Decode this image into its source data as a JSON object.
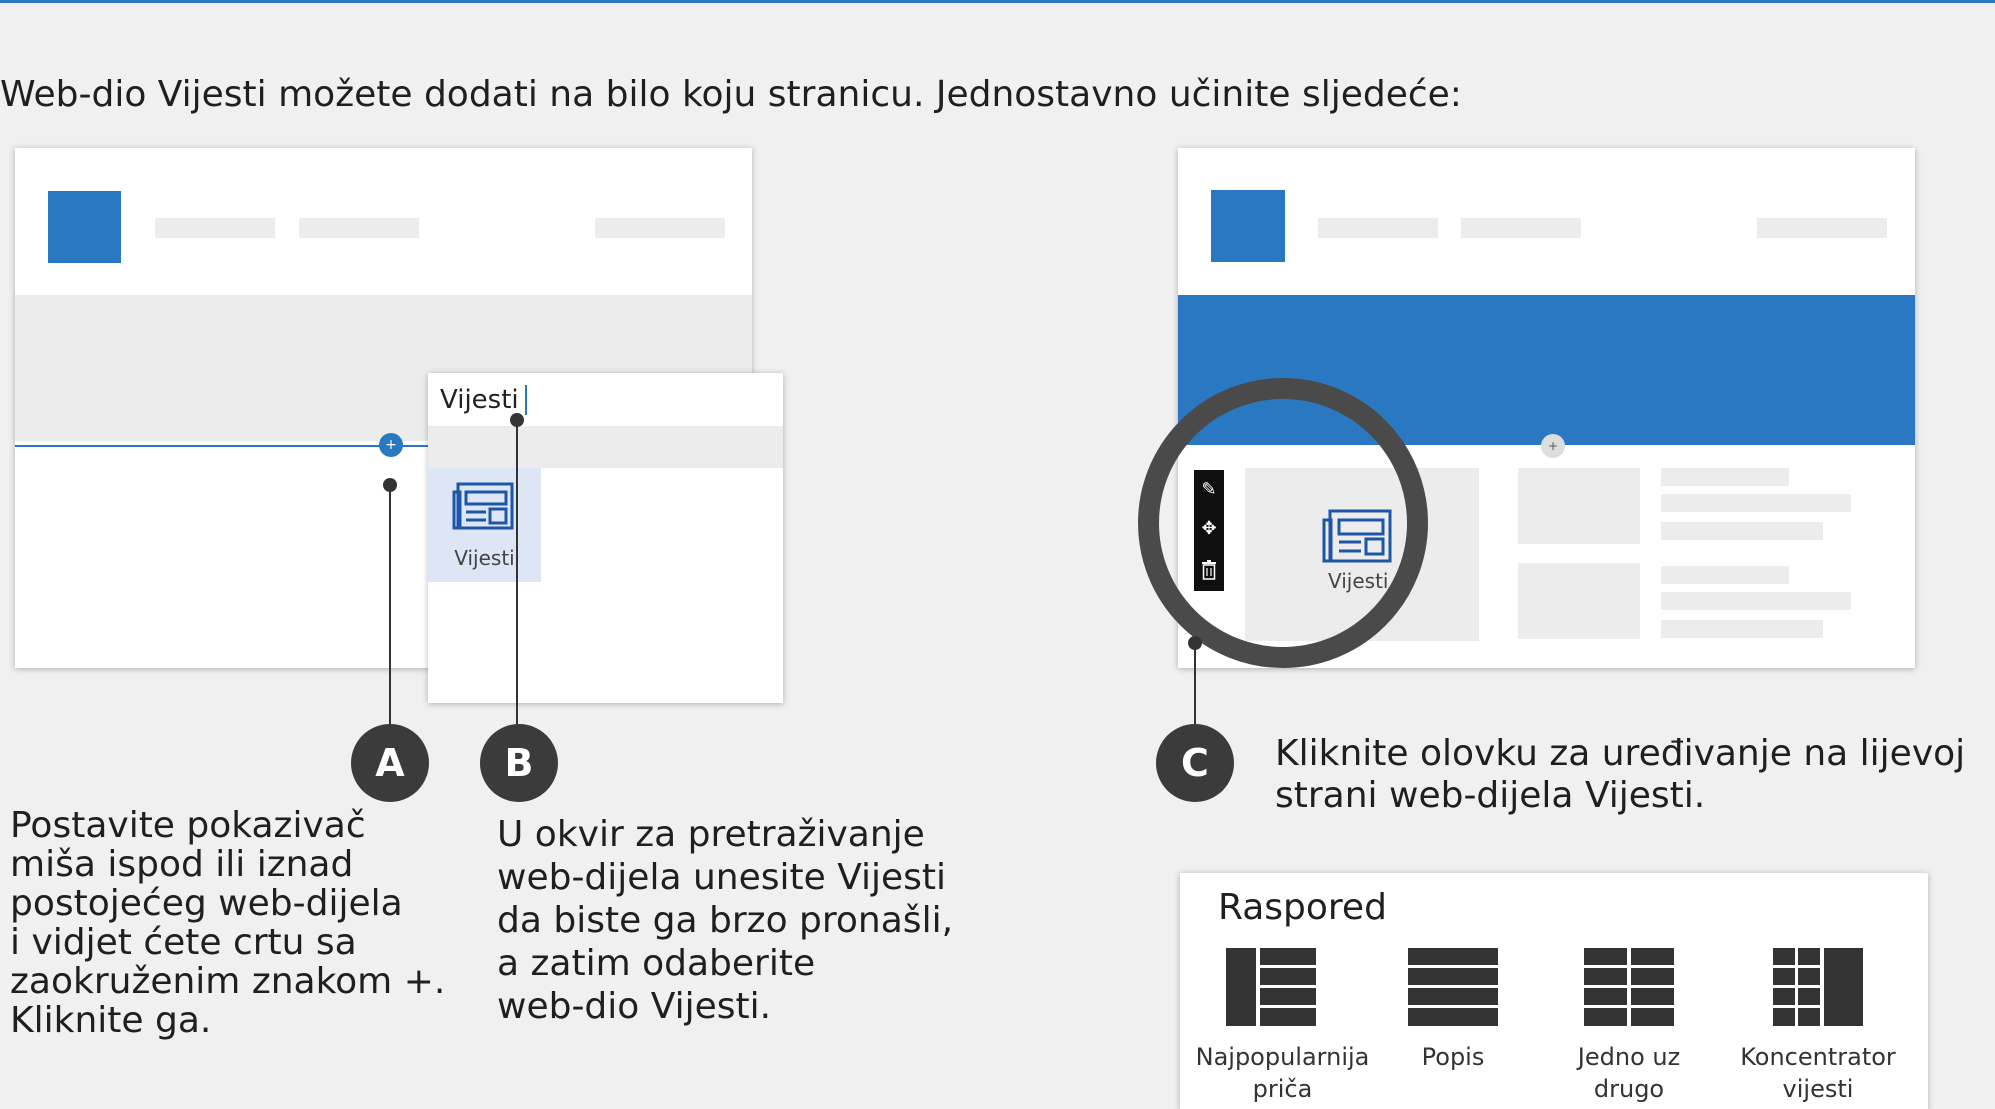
{
  "intro": "Web-dio Vijesti možete dodati na bilo koju stranicu. Jednostavno učinite sljedeće:",
  "panel_b": {
    "search_value": "Vijesti",
    "result_label": "Vijesti"
  },
  "step_a": {
    "badge": "A",
    "lines": [
      "Postavite pokazivač",
      "miša ispod ili iznad",
      "postojećeg web-dijela",
      "i vidjet ćete crtu sa",
      "zaokruženim znakom +.",
      "Kliknite ga."
    ]
  },
  "step_b": {
    "badge": "B",
    "lines": [
      "U okvir za pretraživanje",
      "web-dijela unesite Vijesti",
      "da biste ga brzo pronašli,",
      "a zatim odaberite",
      "web-dio Vijesti."
    ]
  },
  "step_c": {
    "badge": "C",
    "lines": [
      "Kliknite olovku za uređivanje na lijevoj",
      "strani web-dijela Vijesti."
    ]
  },
  "right_panel": {
    "news_label": "Vijesti"
  },
  "layout_panel": {
    "title": "Raspored",
    "options": [
      {
        "line1": "Najpopularnija",
        "line2": "priča",
        "icon": "top-story-layout-icon"
      },
      {
        "line1": "Popis",
        "line2": "",
        "icon": "list-layout-icon"
      },
      {
        "line1": "Jedno uz",
        "line2": "drugo",
        "icon": "side-by-side-layout-icon"
      },
      {
        "line1": "Koncentrator",
        "line2": "vijesti",
        "icon": "hub-news-layout-icon"
      }
    ]
  },
  "colors": {
    "accent": "#2a78c2",
    "badge": "#3b3b3b",
    "background": "#f0f0f0"
  }
}
